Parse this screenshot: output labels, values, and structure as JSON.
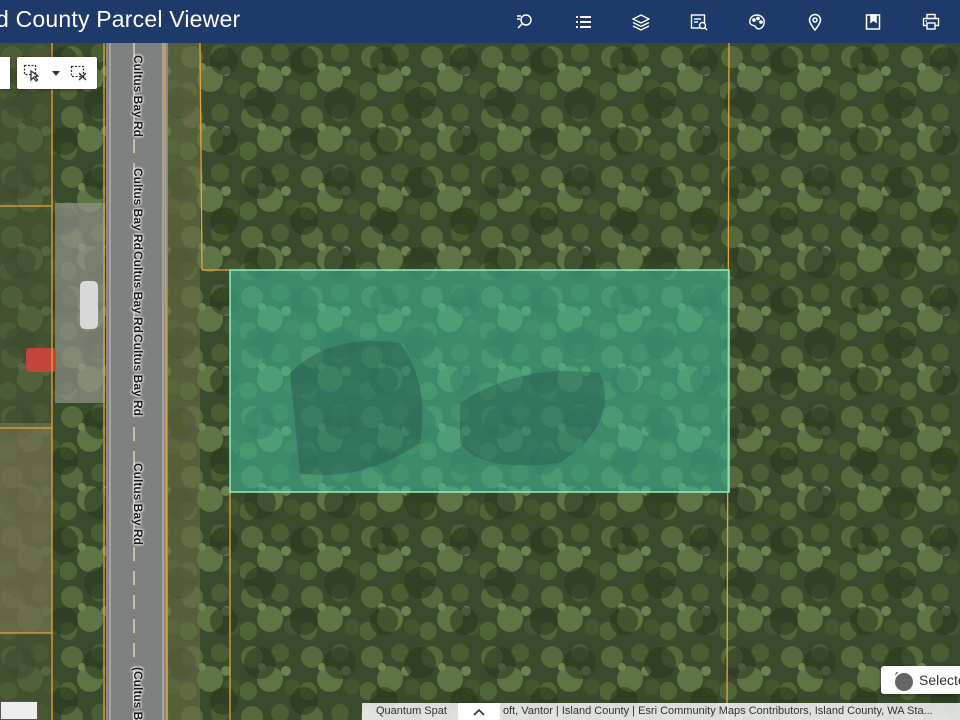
{
  "header": {
    "title": "d County Parcel Viewer",
    "tools": [
      {
        "name": "search-tool",
        "icon": "search-list-icon"
      },
      {
        "name": "legend-tool",
        "icon": "list-icon"
      },
      {
        "name": "layers-tool",
        "icon": "layers-icon"
      },
      {
        "name": "query-tool",
        "icon": "table-search-icon"
      },
      {
        "name": "basemap-tool",
        "icon": "palette-icon"
      },
      {
        "name": "location-tool",
        "icon": "map-pin-icon"
      },
      {
        "name": "bookmarks-tool",
        "icon": "bookmark-icon"
      },
      {
        "name": "print-tool",
        "icon": "printer-icon"
      }
    ]
  },
  "map": {
    "road_labels": [
      {
        "text": "Cultus Bay Rd"
      },
      {
        "text": "Cultus Bay Rd"
      },
      {
        "text": "Cultus Bay Rd"
      },
      {
        "text": "Cultus Bay Rd"
      },
      {
        "text": "Cultus Bay Rd"
      },
      {
        "text": "(Cultus Ba"
      }
    ],
    "selected_parcel_color": "#3fbfa0",
    "parcel_line_color": "#e8a43a",
    "select_button_label": "Selecte",
    "attribution": "Quantum Spat",
    "attribution_rest": "oft, Vantor | Island County | Esri Community Maps Contributors, Island County, WA Sta..."
  },
  "colors": {
    "header_bg": "#1d3a6b"
  }
}
